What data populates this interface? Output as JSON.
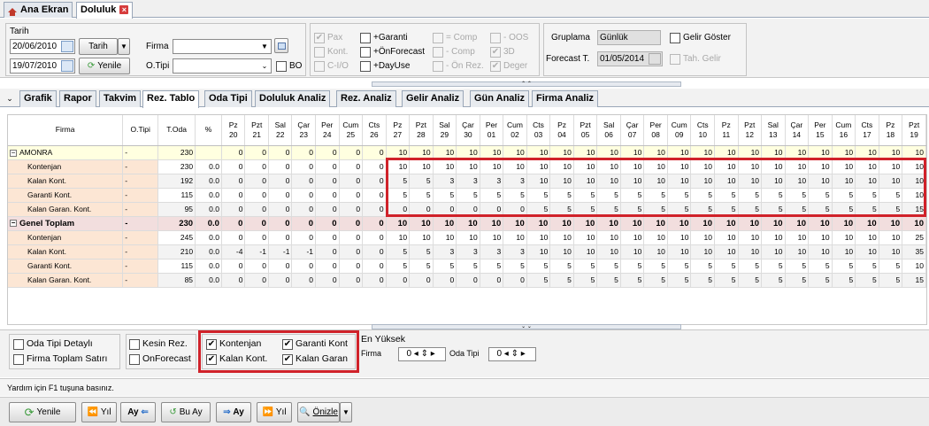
{
  "tabs": {
    "home": "Ana Ekran",
    "active": "Doluluk",
    "close": "×"
  },
  "filter": {
    "tarih_label": "Tarih",
    "date1": "20/06/2010",
    "date2": "19/07/2010",
    "tarih_button": "Tarih",
    "yenile_button": "Yenile",
    "firma_label": "Firma",
    "firma_value": "",
    "otipi_label": "O.Tipi",
    "otipi_value": "",
    "bo_label": "BO",
    "checks": {
      "pax": "Pax",
      "kont": "Kont.",
      "cio": "C-I/O",
      "garanti": "+Garanti",
      "onforecast": "+ÖnForecast",
      "dayuse": "+DayUse",
      "comp_eq": "= Comp",
      "comp_minus": "- Comp",
      "onrez": "- Ön Rez.",
      "oos": "- OOS",
      "d3": "3D",
      "deger": "Deger"
    },
    "gruplama_label": "Gruplama",
    "gruplama_value": "Günlük",
    "forecast_label": "Forecast T.",
    "forecast_value": "01/05/2014",
    "gelir_goster": "Gelir Göster",
    "tah_gelir": "Tah. Gelir"
  },
  "subtabs": [
    "Grafik",
    "Rapor",
    "Takvim",
    "Rez. Tablo",
    "Oda Tipi",
    "Doluluk Analiz",
    "Rez. Analiz",
    "Gelir Analiz",
    "Gün Analiz",
    "Firma Analiz"
  ],
  "table": {
    "headers": [
      "Firma",
      "O.Tipi",
      "T.Oda",
      "%"
    ],
    "days": [
      [
        "Pz",
        "20"
      ],
      [
        "Pzt",
        "21"
      ],
      [
        "Sal",
        "22"
      ],
      [
        "Çar",
        "23"
      ],
      [
        "Per",
        "24"
      ],
      [
        "Cum",
        "25"
      ],
      [
        "Cts",
        "26"
      ],
      [
        "Pz",
        "27"
      ],
      [
        "Pzt",
        "28"
      ],
      [
        "Sal",
        "29"
      ],
      [
        "Çar",
        "30"
      ],
      [
        "Per",
        "01"
      ],
      [
        "Cum",
        "02"
      ],
      [
        "Cts",
        "03"
      ],
      [
        "Pz",
        "04"
      ],
      [
        "Pzt",
        "05"
      ],
      [
        "Sal",
        "06"
      ],
      [
        "Çar",
        "07"
      ],
      [
        "Per",
        "08"
      ],
      [
        "Cum",
        "09"
      ],
      [
        "Cts",
        "10"
      ],
      [
        "Pz",
        "11"
      ],
      [
        "Pzt",
        "12"
      ],
      [
        "Sal",
        "13"
      ],
      [
        "Çar",
        "14"
      ],
      [
        "Per",
        "15"
      ],
      [
        "Cum",
        "16"
      ],
      [
        "Cts",
        "17"
      ],
      [
        "Pz",
        "18"
      ],
      [
        "Pzt",
        "19"
      ]
    ],
    "rows": [
      {
        "type": "amonra",
        "name": "AMONRA",
        "otipi": "-",
        "toda": "230",
        "pct": "",
        "vals": [
          "0",
          "0",
          "0",
          "0",
          "0",
          "0",
          "0",
          "10",
          "10",
          "10",
          "10",
          "10",
          "10",
          "10",
          "10",
          "10",
          "10",
          "10",
          "10",
          "10",
          "10",
          "10",
          "10",
          "10",
          "10",
          "10",
          "10",
          "10",
          "10",
          "10"
        ]
      },
      {
        "type": "sub1",
        "name": "Kontenjan",
        "otipi": "-",
        "toda": "230",
        "pct": "0.0",
        "vals": [
          "0",
          "0",
          "0",
          "0",
          "0",
          "0",
          "0",
          "10",
          "10",
          "10",
          "10",
          "10",
          "10",
          "10",
          "10",
          "10",
          "10",
          "10",
          "10",
          "10",
          "10",
          "10",
          "10",
          "10",
          "10",
          "10",
          "10",
          "10",
          "10",
          "10"
        ]
      },
      {
        "type": "sub2",
        "name": "Kalan Kont.",
        "otipi": "-",
        "toda": "192",
        "pct": "0.0",
        "vals": [
          "0",
          "0",
          "0",
          "0",
          "0",
          "0",
          "0",
          "5",
          "5",
          "3",
          "3",
          "3",
          "3",
          "10",
          "10",
          "10",
          "10",
          "10",
          "10",
          "10",
          "10",
          "10",
          "10",
          "10",
          "10",
          "10",
          "10",
          "10",
          "10",
          "10"
        ]
      },
      {
        "type": "sub1",
        "name": "Garanti Kont.",
        "otipi": "-",
        "toda": "115",
        "pct": "0.0",
        "vals": [
          "0",
          "0",
          "0",
          "0",
          "0",
          "0",
          "0",
          "5",
          "5",
          "5",
          "5",
          "5",
          "5",
          "5",
          "5",
          "5",
          "5",
          "5",
          "5",
          "5",
          "5",
          "5",
          "5",
          "5",
          "5",
          "5",
          "5",
          "5",
          "5",
          "10"
        ]
      },
      {
        "type": "sub2",
        "name": "Kalan Garan. Kont.",
        "otipi": "-",
        "toda": "95",
        "pct": "0.0",
        "vals": [
          "0",
          "0",
          "0",
          "0",
          "0",
          "0",
          "0",
          "0",
          "0",
          "0",
          "0",
          "0",
          "0",
          "5",
          "5",
          "5",
          "5",
          "5",
          "5",
          "5",
          "5",
          "5",
          "5",
          "5",
          "5",
          "5",
          "5",
          "5",
          "5",
          "15"
        ]
      },
      {
        "type": "gt",
        "name": "Genel Toplam",
        "otipi": "-",
        "toda": "230",
        "pct": "0.0",
        "vals": [
          "0",
          "0",
          "0",
          "0",
          "0",
          "0",
          "0",
          "10",
          "10",
          "10",
          "10",
          "10",
          "10",
          "10",
          "10",
          "10",
          "10",
          "10",
          "10",
          "10",
          "10",
          "10",
          "10",
          "10",
          "10",
          "10",
          "10",
          "10",
          "10",
          "10"
        ]
      },
      {
        "type": "sub1",
        "name": "Kontenjan",
        "otipi": "-",
        "toda": "245",
        "pct": "0.0",
        "vals": [
          "0",
          "0",
          "0",
          "0",
          "0",
          "0",
          "0",
          "10",
          "10",
          "10",
          "10",
          "10",
          "10",
          "10",
          "10",
          "10",
          "10",
          "10",
          "10",
          "10",
          "10",
          "10",
          "10",
          "10",
          "10",
          "10",
          "10",
          "10",
          "10",
          "25"
        ]
      },
      {
        "type": "sub2",
        "name": "Kalan Kont.",
        "otipi": "-",
        "toda": "210",
        "pct": "0.0",
        "vals": [
          "-4",
          "-1",
          "-1",
          "-1",
          "0",
          "0",
          "0",
          "5",
          "5",
          "3",
          "3",
          "3",
          "3",
          "10",
          "10",
          "10",
          "10",
          "10",
          "10",
          "10",
          "10",
          "10",
          "10",
          "10",
          "10",
          "10",
          "10",
          "10",
          "10",
          "35"
        ]
      },
      {
        "type": "sub1",
        "name": "Garanti Kont.",
        "otipi": "-",
        "toda": "115",
        "pct": "0.0",
        "vals": [
          "0",
          "0",
          "0",
          "0",
          "0",
          "0",
          "0",
          "5",
          "5",
          "5",
          "5",
          "5",
          "5",
          "5",
          "5",
          "5",
          "5",
          "5",
          "5",
          "5",
          "5",
          "5",
          "5",
          "5",
          "5",
          "5",
          "5",
          "5",
          "5",
          "10"
        ]
      },
      {
        "type": "sub2",
        "name": "Kalan Garan. Kont.",
        "otipi": "-",
        "toda": "85",
        "pct": "0.0",
        "vals": [
          "0",
          "0",
          "0",
          "0",
          "0",
          "0",
          "0",
          "0",
          "0",
          "0",
          "0",
          "0",
          "0",
          "5",
          "5",
          "5",
          "5",
          "5",
          "5",
          "5",
          "5",
          "5",
          "5",
          "5",
          "5",
          "5",
          "5",
          "5",
          "5",
          "15"
        ]
      }
    ]
  },
  "options": {
    "oda_tipi_detayli": "Oda Tipi Detaylı",
    "firma_toplam_satiri": "Firma Toplam Satırı",
    "kesin_rez": "Kesin Rez.",
    "onforecast": "OnForecast",
    "kontenjan": "Kontenjan",
    "kalan_kont": "Kalan Kont.",
    "garanti_kont": "Garanti Kont",
    "kalan_garan": "Kalan Garan",
    "en_yuksek": "En Yüksek",
    "firma": "Firma",
    "firma_val": "0",
    "oda_tipi": "Oda Tipi",
    "oda_tipi_val": "0"
  },
  "status": "Yardım için F1 tuşuna basınız.",
  "toolbar": {
    "yenile": "Yenile",
    "yil_prev": "Yıl",
    "ay_prev": "Ay",
    "bu_ay": "Bu Ay",
    "ay_next": "Ay",
    "yil_next": "Yıl",
    "onizle": "Önizle"
  }
}
